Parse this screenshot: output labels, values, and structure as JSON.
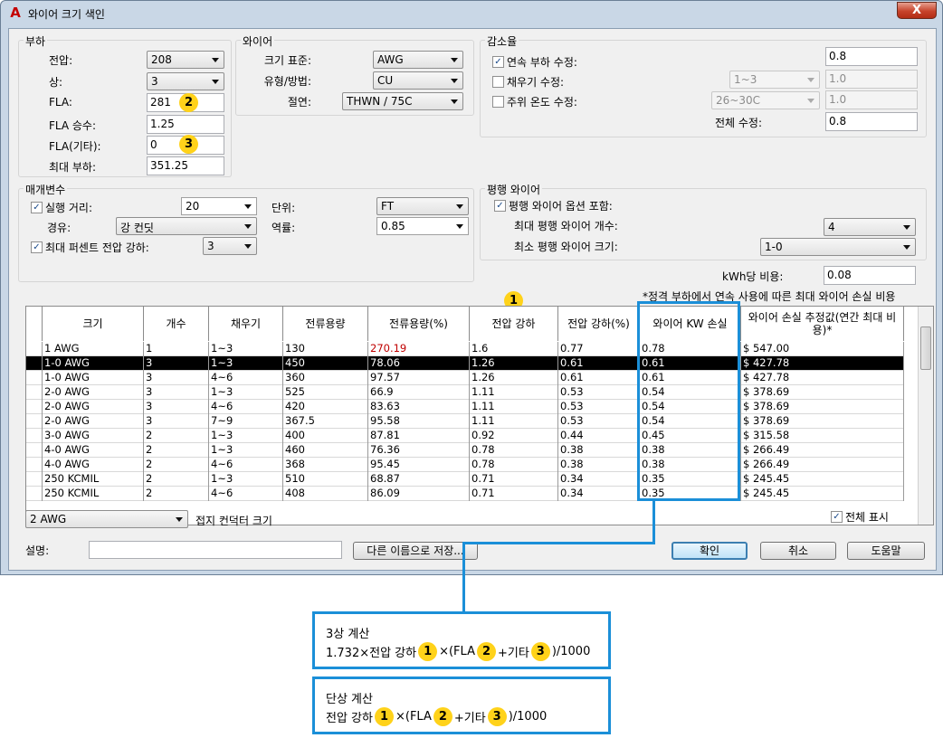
{
  "window": {
    "title": "와이어 크기 색인",
    "app_icon": "A",
    "close_label": "X"
  },
  "load": {
    "title": "부하",
    "voltage_label": "전압:",
    "voltage_value": "208",
    "phase_label": "상:",
    "phase_value": "3",
    "fla_label": "FLA:",
    "fla_value": "281",
    "fla_mult_label": "FLA 승수:",
    "fla_mult_value": "1.25",
    "fla_other_label": "FLA(기타):",
    "fla_other_value": "0",
    "max_load_label": "최대 부하:",
    "max_load_value": "351.25"
  },
  "wire": {
    "title": "와이어",
    "size_std_label": "크기 표준:",
    "size_std_value": "AWG",
    "type_label": "유형/방법:",
    "type_value": "CU",
    "insulation_label": "절연:",
    "insulation_value": "THWN / 75C"
  },
  "derate": {
    "title": "감소율",
    "continuous_label": "연속 부하 수정:",
    "continuous_checked": true,
    "continuous_value": "0.8",
    "fill_label": "채우기 수정:",
    "fill_checked": false,
    "fill_select": "1~3",
    "fill_value": "1.0",
    "ambient_label": "주위 온도 수정:",
    "ambient_checked": false,
    "ambient_select": "26~30C",
    "ambient_value": "1.0",
    "total_label": "전체 수정:",
    "total_value": "0.8"
  },
  "params": {
    "title": "매개변수",
    "run_label": "실행 거리:",
    "run_checked": true,
    "run_value": "20",
    "unit_label": "단위:",
    "unit_value": "FT",
    "route_label": "경유:",
    "route_value": "강 컨딧",
    "pf_label": "역률:",
    "pf_value": "0.85",
    "maxdrop_label": "최대 퍼센트 전압 강하:",
    "maxdrop_checked": true,
    "maxdrop_value": "3"
  },
  "parallel": {
    "title": "평행 와이어",
    "include_label": "평행 와이어 옵션 포함:",
    "include_checked": true,
    "max_count_label": "최대 평행 와이어 개수:",
    "max_count_value": "4",
    "min_size_label": "최소 평행 와이어 크기:",
    "min_size_value": "1-0"
  },
  "cost": {
    "kwh_label": "kWh당 비용:",
    "kwh_value": "0.08",
    "note": "*정격 부하에서 연속 사용에 따른 최대 와이어 손실 비용"
  },
  "table": {
    "headers": [
      "크기",
      "개수",
      "채우기",
      "전류용량",
      "전류용량(%)",
      "전압 강하",
      "전압 강하(%)",
      "와이어 KW 손실",
      "와이어 손실 추정값(연간 최대 비용)*"
    ],
    "rows": [
      [
        "1 AWG",
        "1",
        "1~3",
        "130",
        "270.19",
        "1.6",
        "0.77",
        "0.78",
        "$ 547.00"
      ],
      [
        "1-0 AWG",
        "3",
        "1~3",
        "450",
        "78.06",
        "1.26",
        "0.61",
        "0.61",
        "$ 427.78"
      ],
      [
        "1-0 AWG",
        "3",
        "4~6",
        "360",
        "97.57",
        "1.26",
        "0.61",
        "0.61",
        "$ 427.78"
      ],
      [
        "2-0 AWG",
        "3",
        "1~3",
        "525",
        "66.9",
        "1.11",
        "0.53",
        "0.54",
        "$ 378.69"
      ],
      [
        "2-0 AWG",
        "3",
        "4~6",
        "420",
        "83.63",
        "1.11",
        "0.53",
        "0.54",
        "$ 378.69"
      ],
      [
        "2-0 AWG",
        "3",
        "7~9",
        "367.5",
        "95.58",
        "1.11",
        "0.53",
        "0.54",
        "$ 378.69"
      ],
      [
        "3-0 AWG",
        "2",
        "1~3",
        "400",
        "87.81",
        "0.92",
        "0.44",
        "0.45",
        "$ 315.58"
      ],
      [
        "4-0 AWG",
        "2",
        "1~3",
        "460",
        "76.36",
        "0.78",
        "0.38",
        "0.38",
        "$ 266.49"
      ],
      [
        "4-0 AWG",
        "2",
        "4~6",
        "368",
        "95.45",
        "0.78",
        "0.38",
        "0.38",
        "$ 266.49"
      ],
      [
        "250 KCMIL",
        "2",
        "1~3",
        "510",
        "68.87",
        "0.71",
        "0.34",
        "0.35",
        "$ 245.45"
      ],
      [
        "250 KCMIL",
        "2",
        "4~6",
        "408",
        "86.09",
        "0.71",
        "0.34",
        "0.35",
        "$ 245.45"
      ]
    ],
    "selected_row": 1,
    "red_value": "270.19"
  },
  "ground": {
    "value": "2 AWG",
    "label": "접지 컨덕터 크기"
  },
  "show_all": {
    "label": "전체 표시",
    "checked": true
  },
  "description": {
    "label": "설명:",
    "value": ""
  },
  "buttons": {
    "save_as": "다른 이름으로 저장...",
    "ok": "확인",
    "cancel": "취소",
    "help": "도움말"
  },
  "badges": {
    "one": "1",
    "two": "2",
    "three": "3"
  },
  "formula_three": {
    "title": "3상 계산",
    "p1": "1.732×전압 강하",
    "p2": "×(FLA",
    "p3": "+기타",
    "p4": ")/1000"
  },
  "formula_single": {
    "title": "단상 계산",
    "p1": "전압 강하",
    "p2": "×(FLA",
    "p3": "+기타",
    "p4": ")/1000"
  },
  "colors": {
    "accent_blue": "#1b8fd8",
    "badge_yellow": "#ffd21a",
    "highlight_red": "#c00000"
  }
}
